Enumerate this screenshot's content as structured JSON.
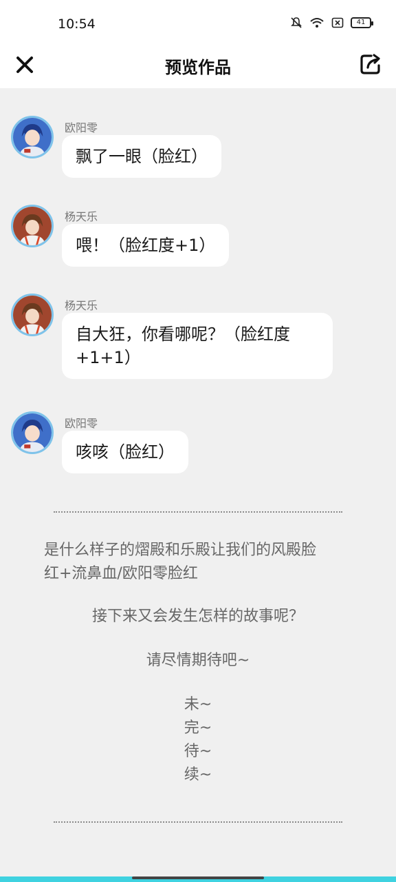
{
  "status": {
    "time": "10:54",
    "battery": "41"
  },
  "header": {
    "title": "预览作品"
  },
  "messages": [
    {
      "sender": "欧阳零",
      "text": "飘了一眼（脸红）"
    },
    {
      "sender": "杨天乐",
      "text": "喂！（脸红度+1）"
    },
    {
      "sender": "杨天乐",
      "text_line1": "自大狂，你看哪呢？（脸红度",
      "text_line2": "+1+1）"
    },
    {
      "sender": "欧阳零",
      "text": "咳咳（脸红）"
    }
  ],
  "narration": {
    "line1": "是什么样子的熠殿和乐殿让我们的风殿脸",
    "line2": "红+流鼻血/欧阳零脸红",
    "line3": "接下来又会发生怎样的故事呢？",
    "line4": "请尽情期待吧~",
    "end1": "未~",
    "end2": "完~",
    "end3": "待~",
    "end4": "续~"
  },
  "colors": {
    "accent": "#3fd2e0",
    "avatar_ring": "#7ec3ea"
  },
  "icons": {
    "close": "close-icon",
    "share": "share-icon"
  }
}
